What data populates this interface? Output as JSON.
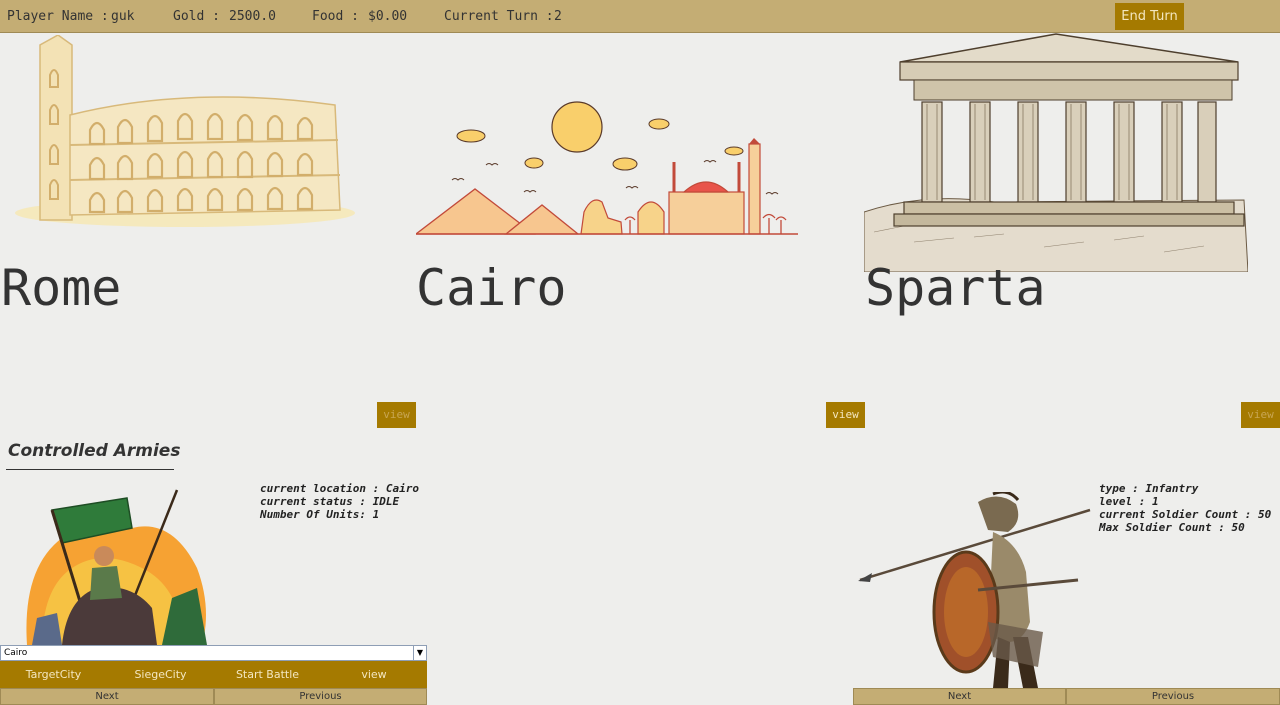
{
  "topbar": {
    "player_label": "Player Name :",
    "player_value": "guk",
    "gold_label": "Gold :",
    "gold_value": "2500.0",
    "food_label": "Food :",
    "food_value": "$0.00",
    "turn_label": "Current Turn :",
    "turn_value": "2",
    "end_turn": "End Turn"
  },
  "cities": [
    {
      "name": "Rome",
      "view": "view",
      "image": "colosseum-illustration"
    },
    {
      "name": "Cairo",
      "view": "view",
      "image": "cairo-skyline-illustration"
    },
    {
      "name": "Sparta",
      "view": "view",
      "image": "parthenon-sketch"
    }
  ],
  "armies": {
    "title": "Controlled Armies",
    "info": {
      "location": "current location : Cairo",
      "status": "current status : IDLE",
      "units": "Number Of Units: 1"
    },
    "select_value": "Cairo",
    "actions": [
      "TargetCity",
      "SiegeCity",
      "Start Battle",
      "view"
    ],
    "next": "Next",
    "previous": "Previous"
  },
  "unit": {
    "info": {
      "type": "type : Infantry",
      "level": "level : 1",
      "current": "current Soldier Count : 50",
      "max": "Max Soldier Count : 50"
    },
    "next": "Next",
    "previous": "Previous"
  },
  "colors": {
    "topbar": "#c4ad74",
    "button": "#a57a00",
    "background": "#eeeeec"
  }
}
